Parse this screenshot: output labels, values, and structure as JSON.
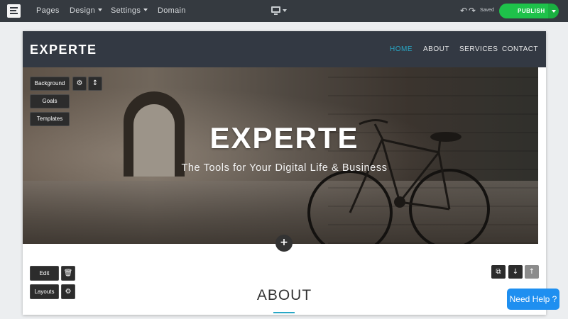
{
  "topbar": {
    "menu": [
      {
        "label": "Pages",
        "has_caret": false
      },
      {
        "label": "Design",
        "has_caret": true
      },
      {
        "label": "Settings",
        "has_caret": true
      },
      {
        "label": "Domain",
        "has_caret": false
      }
    ],
    "device_icon": "desktop-monitor-icon",
    "undo_icon": "undo-icon",
    "redo_icon": "redo-icon",
    "status": "Saved",
    "publish_label": "PUBLISH",
    "publish_icon": "megaphone-icon",
    "publish_color": "#1ec24a"
  },
  "site": {
    "logo": "EXPERTE",
    "nav": [
      {
        "label": "HOME",
        "active": true
      },
      {
        "label": "ABOUT",
        "active": false
      },
      {
        "label": "SERVICES",
        "active": false
      },
      {
        "label": "CONTACT",
        "active": false
      }
    ],
    "accent_color": "#28a7c6",
    "hero": {
      "title": "EXPERTE",
      "subtitle": "The Tools for Your Digital Life & Business"
    },
    "about_title": "ABOUT"
  },
  "hero_tools": {
    "background": "Background",
    "goals": "Goals",
    "templates": "Templates",
    "settings_icon": "gear-icon",
    "resize_icon": "vertical-resize-icon"
  },
  "section_tools": {
    "edit": "Edit",
    "layouts": "Layouts",
    "delete_icon": "trash-icon",
    "settings_icon": "gear-icon",
    "add_icon": "plus-icon",
    "copy_icon": "copy-icon",
    "move_down_icon": "arrow-down-icon",
    "move_up_icon": "arrow-up-icon"
  },
  "help_button": "Need Help ?"
}
